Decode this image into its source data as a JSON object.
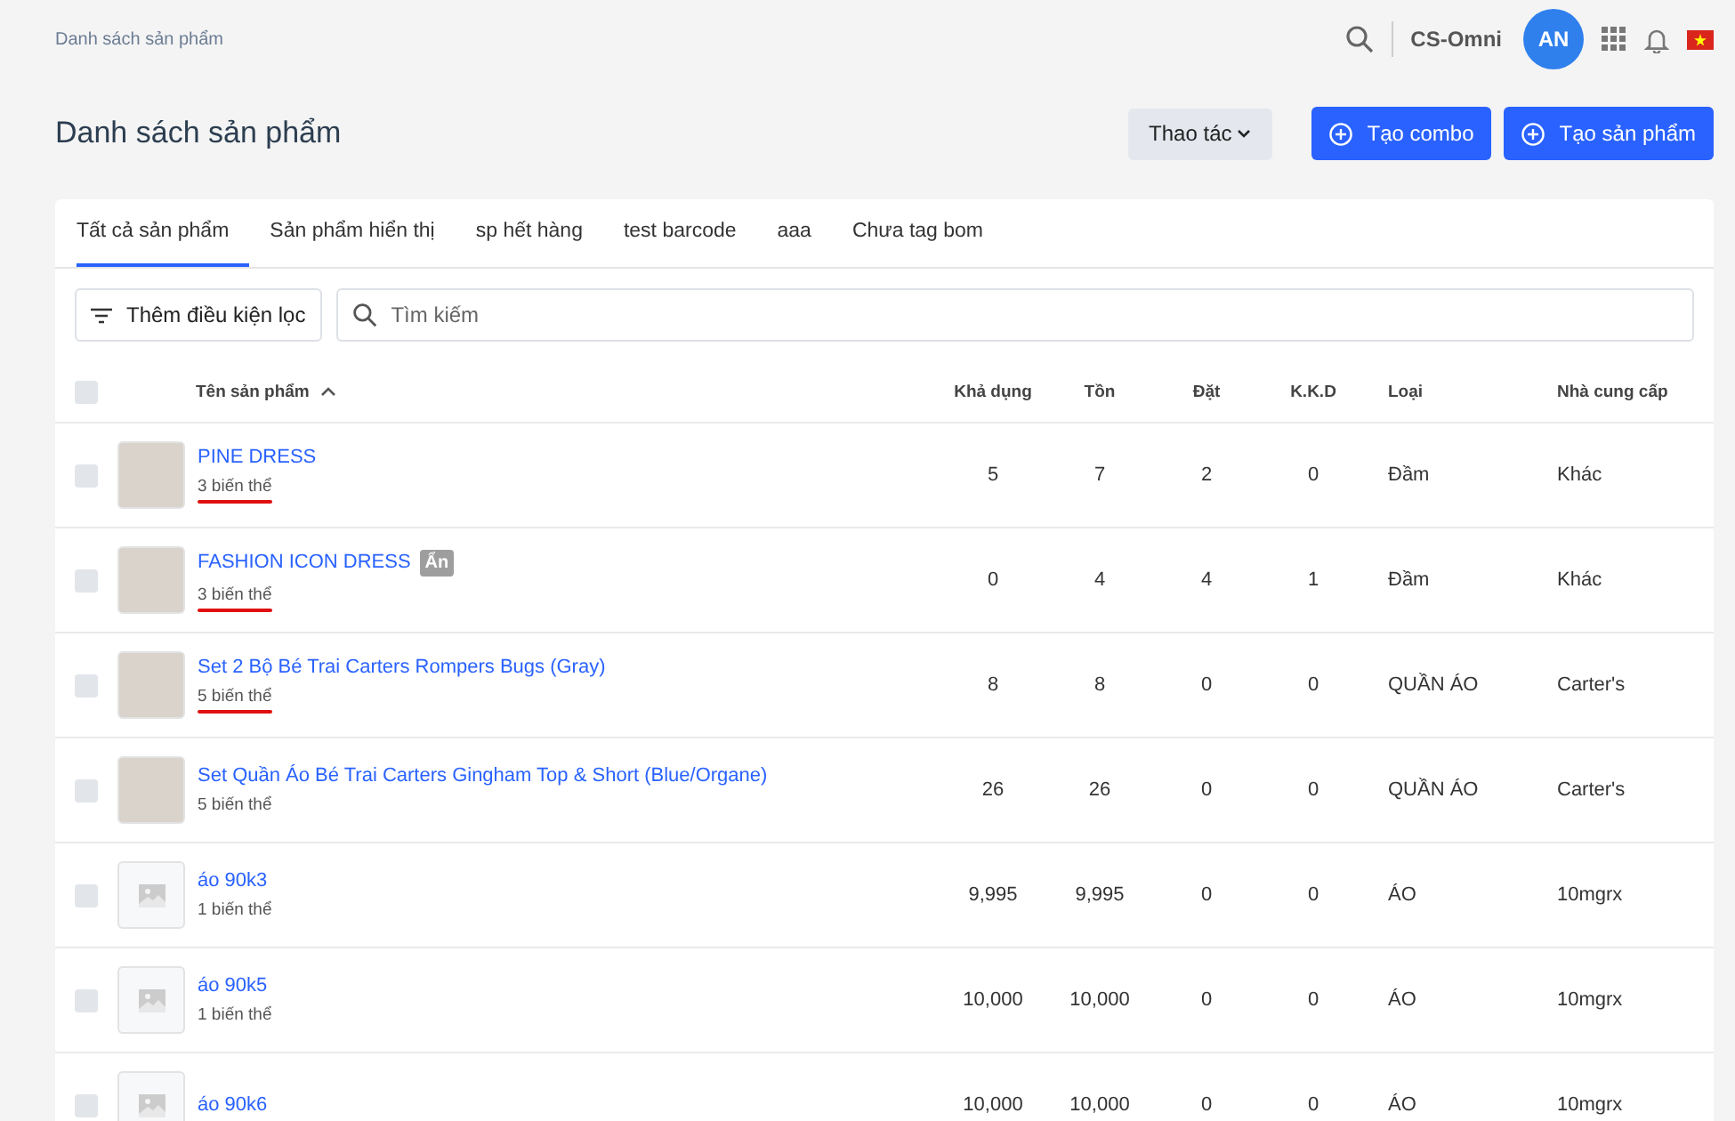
{
  "breadcrumb": "Danh sách sản phẩm",
  "header": {
    "store": "CS-Omni",
    "avatar": "AN"
  },
  "title": "Danh sách sản phẩm",
  "actions": {
    "menu": "Thao tác",
    "buttons": [
      "Tạo combo",
      "Tạo sản phẩm"
    ]
  },
  "tabs": [
    {
      "label": "Tất cả sản phẩm",
      "selected": true
    },
    {
      "label": "Sản phẩm hiển thị",
      "selected": false
    },
    {
      "label": "sp hết hàng",
      "selected": false
    },
    {
      "label": "test barcode",
      "selected": false
    },
    {
      "label": "aaa",
      "selected": false
    },
    {
      "label": "Chưa tag bom",
      "selected": false
    }
  ],
  "filter": {
    "button": "Thêm điều kiện lọc",
    "search_placeholder": "Tìm kiếm"
  },
  "table": {
    "select_all_checked": false,
    "name_header": "Tên sản phẩm",
    "columns": [
      "Khả dụng",
      "Tồn",
      "Đặt",
      "K.K.D",
      "Loại",
      "Nhà cung cấp"
    ],
    "rows": [
      {
        "kind": "photo",
        "checked": false,
        "name": "PINE DRESS",
        "badge": null,
        "variants": "3 biến thể",
        "underlined": true,
        "cells": [
          "5",
          "7",
          "2",
          "0",
          "Đầm",
          "Khác"
        ]
      },
      {
        "kind": "photo",
        "checked": false,
        "name": "FASHION ICON DRESS",
        "badge": "Ẩn",
        "variants": "3 biến thể",
        "underlined": true,
        "cells": [
          "0",
          "4",
          "4",
          "1",
          "Đầm",
          "Khác"
        ]
      },
      {
        "kind": "photo",
        "checked": false,
        "name": "Set 2 Bộ Bé Trai Carters Rompers Bugs (Gray)",
        "badge": null,
        "variants": "5 biến thể",
        "underlined": true,
        "cells": [
          "8",
          "8",
          "0",
          "0",
          "QUẦN ÁO",
          "Carter's"
        ]
      },
      {
        "kind": "photo",
        "checked": false,
        "name": "Set Quần Áo Bé Trai Carters Gingham Top & Short (Blue/Organe)",
        "badge": null,
        "variants": "5 biến thể",
        "underlined": false,
        "cells": [
          "26",
          "26",
          "0",
          "0",
          "QUẦN ÁO",
          "Carter's"
        ]
      },
      {
        "kind": "placeholder",
        "checked": false,
        "name": "áo 90k3",
        "badge": null,
        "variants": "1 biến thể",
        "underlined": false,
        "cells": [
          "9,995",
          "9,995",
          "0",
          "0",
          "ÁO",
          "10mgrx"
        ]
      },
      {
        "kind": "placeholder",
        "checked": false,
        "name": "áo 90k5",
        "badge": null,
        "variants": "1 biến thể",
        "underlined": false,
        "cells": [
          "10,000",
          "10,000",
          "0",
          "0",
          "ÁO",
          "10mgrx"
        ]
      },
      {
        "kind": "placeholder",
        "checked": false,
        "name": "áo 90k6",
        "badge": null,
        "variants": null,
        "underlined": false,
        "cells": [
          "10,000",
          "10,000",
          "0",
          "0",
          "ÁO",
          "10mgrx"
        ]
      }
    ]
  }
}
